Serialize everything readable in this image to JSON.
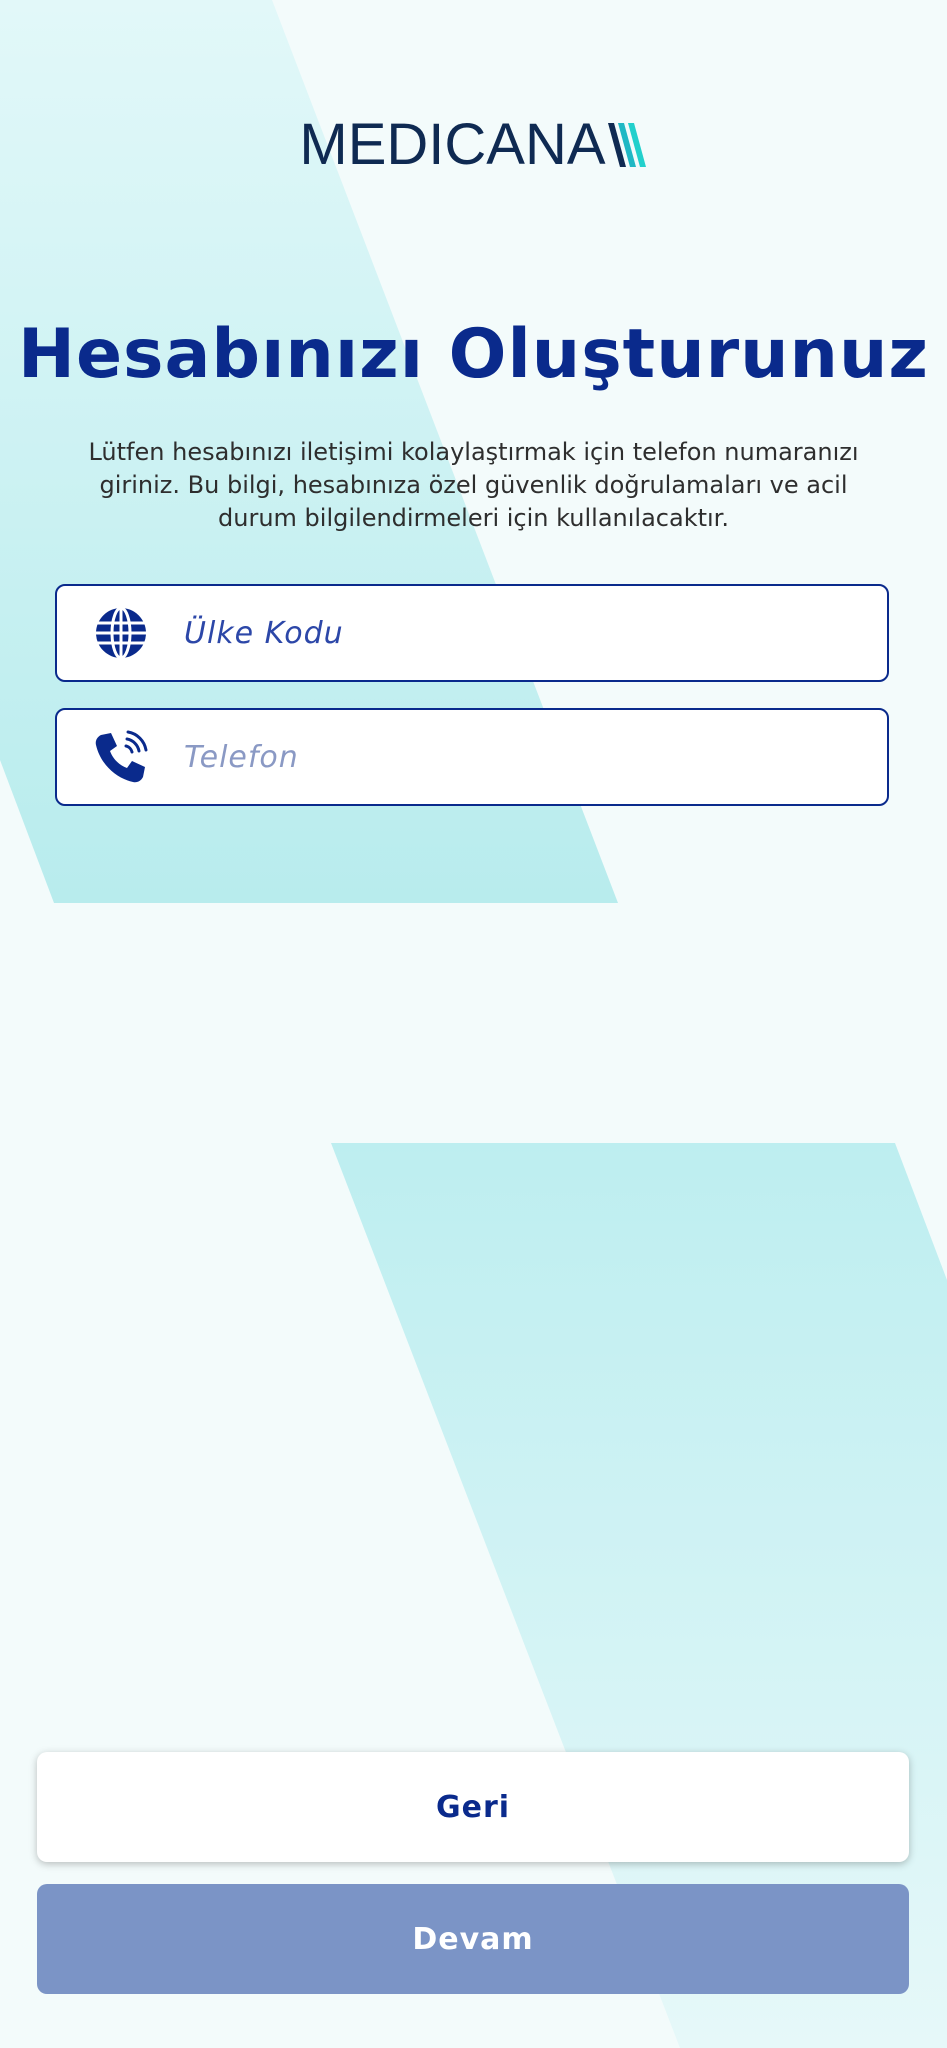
{
  "brand": {
    "logo_text": "MEDICANA",
    "logo_icon": "medicana-slash-mark-icon",
    "colors": {
      "primary": "#0a2a8c",
      "accent": "#1ec6c9",
      "logo_dark": "#0f2a52",
      "disabled_button": "#7b94c6"
    }
  },
  "header": {
    "title": "Hesabınızı Oluşturunuz",
    "description": "Lütfen hesabınızı iletişimi kolaylaştırmak için telefon numaranızı giriniz. Bu bilgi, hesabınıza özel güvenlik doğrulamaları ve acil durum bilgilendirmeleri için kullanılacaktır."
  },
  "form": {
    "country_code": {
      "icon": "globe-icon",
      "value": "Ülke Kodu"
    },
    "phone": {
      "icon": "phone-call-icon",
      "placeholder": "Telefon"
    }
  },
  "actions": {
    "back_label": "Geri",
    "continue_label": "Devam"
  }
}
